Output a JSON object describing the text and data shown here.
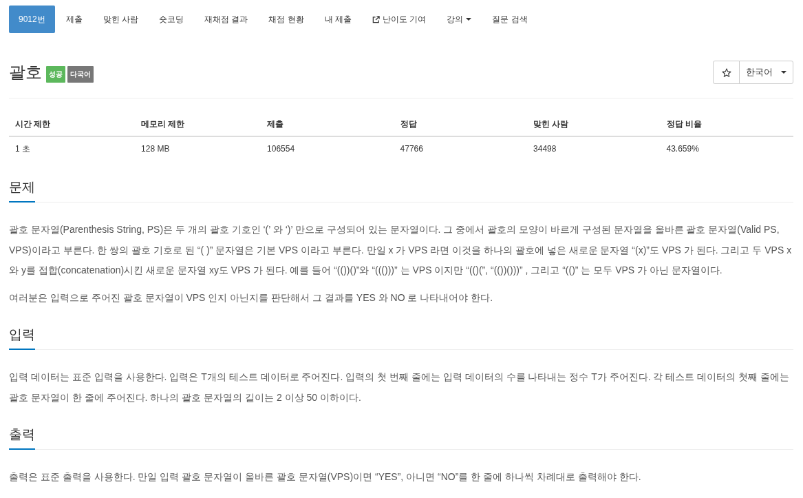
{
  "nav": {
    "tabs": [
      {
        "label": "9012번",
        "selected": true,
        "kind": "plain"
      },
      {
        "label": "제출",
        "selected": false,
        "kind": "plain"
      },
      {
        "label": "맞힌 사람",
        "selected": false,
        "kind": "plain"
      },
      {
        "label": "숏코딩",
        "selected": false,
        "kind": "plain"
      },
      {
        "label": "재채점 결과",
        "selected": false,
        "kind": "plain"
      },
      {
        "label": "채점 현황",
        "selected": false,
        "kind": "plain"
      },
      {
        "label": "내 제출",
        "selected": false,
        "kind": "plain"
      },
      {
        "label": "난이도 기여",
        "selected": false,
        "kind": "external"
      },
      {
        "label": "강의",
        "selected": false,
        "kind": "dropdown"
      },
      {
        "label": "질문 검색",
        "selected": false,
        "kind": "plain"
      }
    ]
  },
  "problem": {
    "title": "괄호",
    "badges": [
      {
        "label": "성공",
        "color": "#5cb85c"
      },
      {
        "label": "다국어",
        "color": "#777777"
      }
    ],
    "language_select": "한국어"
  },
  "stats": {
    "columns": [
      "시간 제한",
      "메모리 제한",
      "제출",
      "정답",
      "맞힌 사람",
      "정답 비율"
    ],
    "rows": [
      [
        "1 초",
        "128 MB",
        "106554",
        "47766",
        "34498",
        "43.659%"
      ]
    ]
  },
  "sections": [
    {
      "heading": "문제",
      "paragraphs": [
        "괄호 문자열(Parenthesis String, PS)은 두 개의 괄호 기호인 ‘(’ 와 ‘)’ 만으로 구성되어 있는 문자열이다. 그 중에서 괄호의 모양이 바르게 구성된 문자열을 올바른 괄호 문자열(Valid PS, VPS)이라고 부른다. 한 쌍의 괄호 기호로 된 “( )” 문자열은 기본 VPS 이라고 부른다. 만일 x 가 VPS 라면 이것을 하나의 괄호에 넣은 새로운 문자열 “(x)”도 VPS 가 된다. 그리고 두 VPS x 와 y를 접합(concatenation)시킨 새로운 문자열 xy도 VPS 가 된다. 예를 들어 “(())()”와 “((()))” 는 VPS 이지만 “(()(”, “(())()))” , 그리고 “(()” 는 모두 VPS 가 아닌 문자열이다.",
        "여러분은 입력으로 주어진 괄호 문자열이 VPS 인지 아닌지를 판단해서 그 결과를 YES 와 NO 로 나타내어야 한다."
      ]
    },
    {
      "heading": "입력",
      "paragraphs": [
        "입력 데이터는 표준 입력을 사용한다. 입력은 T개의 테스트 데이터로 주어진다. 입력의 첫 번째 줄에는 입력 데이터의 수를 나타내는 정수 T가 주어진다. 각 테스트 데이터의 첫째 줄에는 괄호 문자열이 한 줄에 주어진다. 하나의 괄호 문자열의 길이는 2 이상 50 이하이다."
      ]
    },
    {
      "heading": "출력",
      "paragraphs": [
        "출력은 표준 출력을 사용한다. 만일 입력 괄호 문자열이 올바른 괄호 문자열(VPS)이면 “YES”, 아니면 “NO”를 한 줄에 하나씩 차례대로 출력해야 한다."
      ]
    }
  ]
}
